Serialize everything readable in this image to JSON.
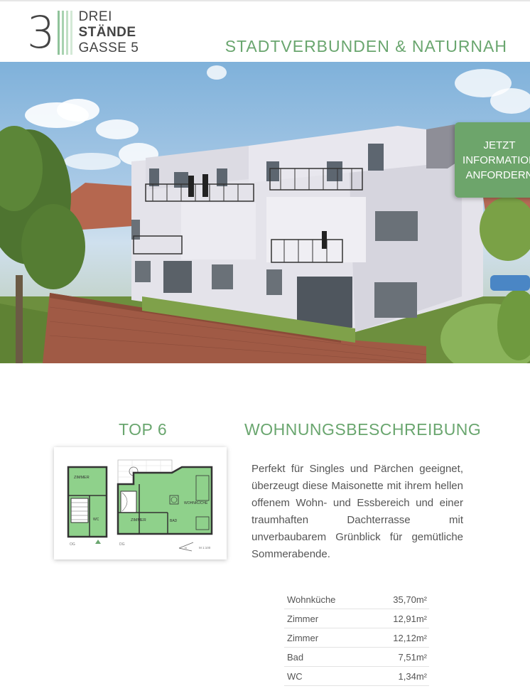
{
  "header": {
    "logo_number": "3",
    "logo_line1": "DREI",
    "logo_line2": "STÄNDE",
    "logo_line3": "GASSE 5",
    "tagline": "STADTVERBUNDEN & NATURNAH"
  },
  "hero": {
    "cta_line1": "JETZT",
    "cta_line2": "INFORMATION",
    "cta_line3": "ANFORDERN"
  },
  "apartment": {
    "title": "TOP 6",
    "section_title": "WOHNUNGSBESCHREIBUNG",
    "description": "Perfekt für Singles und Pärchen geeignet, überzeugt diese Maisonette mit ihrem hellen offenem Wohn- und Essbereich und einer traumhaften Dachterrasse mit unverbaubarem Grünblick für gemütliche Sommerabende.",
    "floorplan": {
      "label_og": "OG",
      "label_dg": "DG",
      "room_zimmer1": "ZIMMER",
      "room_zimmer2": "ZIMMER",
      "room_wohnkueche": "WOHNKÜCHE",
      "room_bad": "BAD",
      "room_wc": "WC",
      "scale": "M 1:100"
    },
    "areas": [
      {
        "room": "Wohnküche",
        "size": "35,70m²"
      },
      {
        "room": "Zimmer",
        "size": "12,91m²"
      },
      {
        "room": "Zimmer",
        "size": "12,12m²"
      },
      {
        "room": "Bad",
        "size": "7,51m²"
      },
      {
        "room": "WC",
        "size": "1,34m²"
      }
    ]
  },
  "colors": {
    "accent_green": "#6aa66f",
    "cta_green": "#6da56b"
  }
}
